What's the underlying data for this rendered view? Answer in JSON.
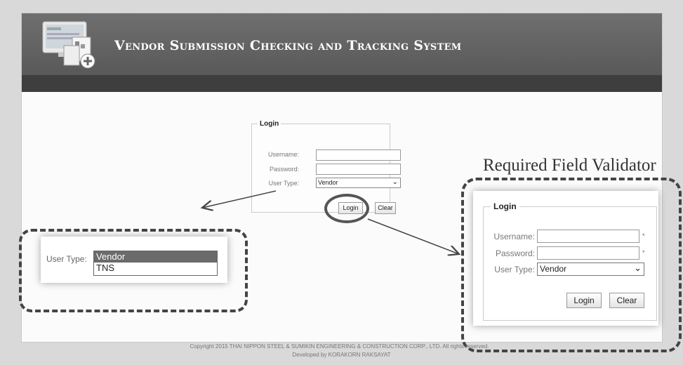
{
  "header": {
    "title": "Vendor Submission Checking and Tracking System"
  },
  "login_small": {
    "legend": "Login",
    "username_label": "Username:",
    "password_label": "Password:",
    "usertype_label": "User Type:",
    "usertype_value": "Vendor",
    "login_button": "Login",
    "clear_button": "Clear"
  },
  "validator_callout": {
    "title": "Required Field Validator",
    "legend": "Login",
    "username_label": "Username:",
    "password_label": "Password:",
    "usertype_label": "User Type:",
    "usertype_value": "Vendor",
    "required_mark": "*",
    "login_button": "Login",
    "clear_button": "Clear"
  },
  "dropdown_callout": {
    "usertype_label": "User Type:",
    "options": [
      "Vendor",
      "TNS"
    ],
    "selected": "Vendor"
  },
  "footer": {
    "copyright": "Copyright 2015 THAI NIPPON STEEL & SUMIKIN ENGINEERING & CONSTRUCTION CORP., LTD. All rights reserved.",
    "developer": "Developed by KORAKORN RAKSAYAT"
  },
  "colors": {
    "header": "#666666",
    "subbar": "#3e3e3e",
    "callout_border": "#444444",
    "selected_option": "#6b6b6b"
  }
}
